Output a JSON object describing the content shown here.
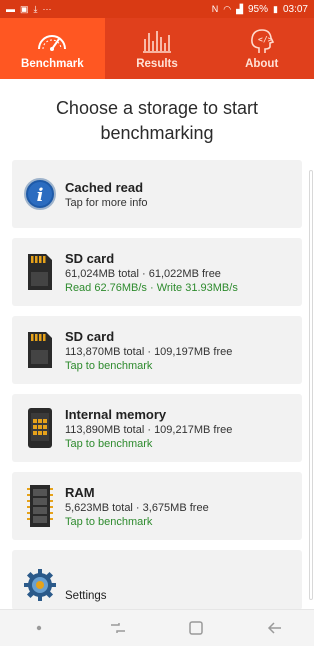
{
  "status_bar": {
    "battery": "95%",
    "time": "03:07"
  },
  "tabs": [
    {
      "label": "Benchmark",
      "icon": "speedometer-icon",
      "active": true
    },
    {
      "label": "Results",
      "icon": "bar-chart-icon",
      "active": false
    },
    {
      "label": "About",
      "icon": "head-code-icon",
      "active": false
    }
  ],
  "heading": "Choose a storage to start benchmarking",
  "items": [
    {
      "title": "Cached read",
      "subtitle": "Tap for more info",
      "status": "",
      "icon": "info-icon"
    },
    {
      "title": "SD card",
      "subtitle": "61,024MB total · 61,022MB free",
      "status": "Read 62.76MB/s · Write 31.93MB/s",
      "icon": "sd-card-icon"
    },
    {
      "title": "SD card",
      "subtitle": "113,870MB total · 109,197MB free",
      "status": "Tap to benchmark",
      "icon": "sd-card-icon"
    },
    {
      "title": "Internal memory",
      "subtitle": "113,890MB total · 109,217MB free",
      "status": "Tap to benchmark",
      "icon": "phone-memory-icon"
    },
    {
      "title": "RAM",
      "subtitle": "5,623MB total · 3,675MB free",
      "status": "Tap to benchmark",
      "icon": "ram-icon"
    }
  ],
  "settings": {
    "label": "Settings",
    "icon": "gear-icon"
  },
  "colors": {
    "primary": "#e0401c",
    "active_tab": "#ff5722",
    "status_green": "#2e8b2e",
    "card_bg": "#f2f2f2"
  }
}
